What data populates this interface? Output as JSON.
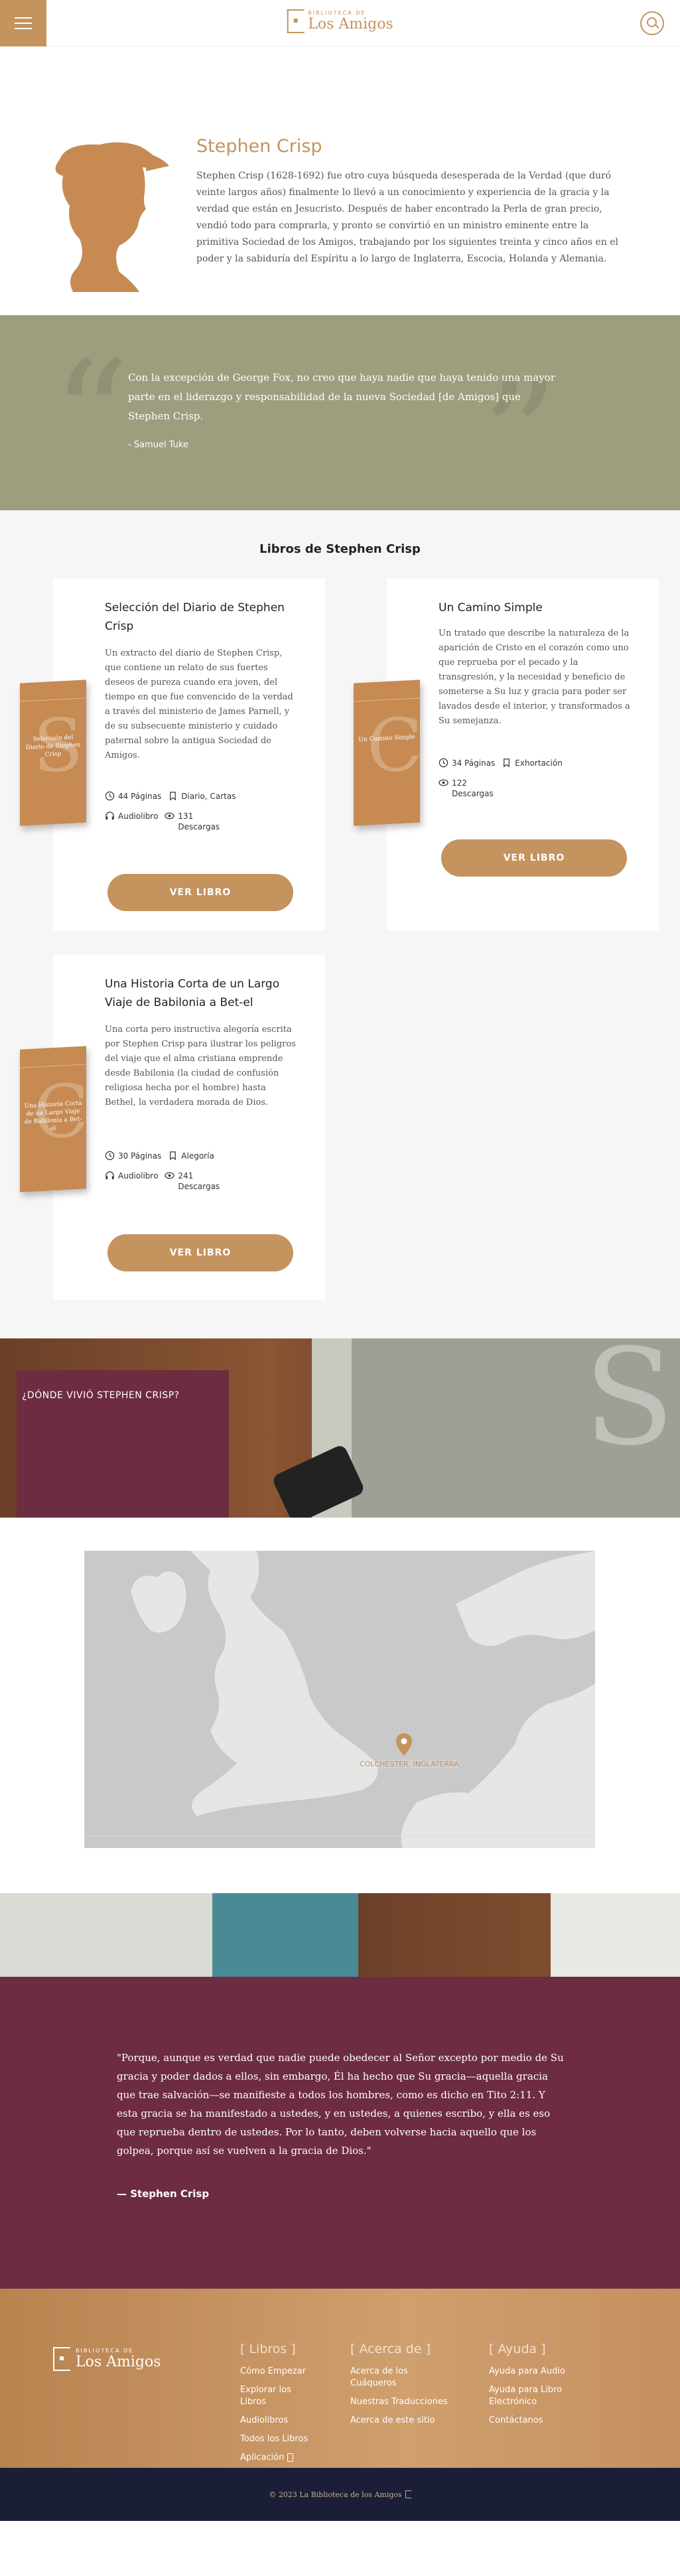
{
  "header": {
    "logo_small": "BIBLIOTECA DE",
    "logo_big": "Los Amigos",
    "icons": {
      "menu": "hamburger-icon",
      "search": "search-icon"
    },
    "accent": "#c4935e"
  },
  "author": {
    "name": "Stephen Crisp",
    "bio": "Stephen Crisp (1628-1692) fue otro cuya búsqueda desesperada de la Verdad (que duró veinte largos años) finalmente lo llevó a un conocimiento y experiencia de la gracia y la verdad que están en Jesucristo. Después de haber encontrado la Perla de gran precio, vendió todo para comprarla, y pronto se convirtió en un ministro eminente entre la primitiva Sociedad de los Amigos, trabajando por los siguientes treinta y cinco años en el poder y la sabiduría del Espíritu a lo largo de Inglaterra, Escocia, Holanda y Alemania."
  },
  "quote": {
    "text": "Con la excepción de George Fox, no creo que haya nadie que haya tenido una mayor parte en el liderazgo y responsabilidad de la nueva Sociedad [de Amigos] que Stephen Crisp.",
    "author": "- Samuel Tuke"
  },
  "books": {
    "title": "Libros de Stephen Crisp",
    "items": [
      {
        "title": "Selección del Diario de Stephen Crisp",
        "desc": "Un extracto del diario de Stephen Crisp, que contiene un relato de sus fuertes deseos de pureza cuando era joven, del tiempo en que fue convencido de la verdad a través del ministerio de James Parnell, y de su subsecuente ministerio y cuidado paternal sobre la antigua Sociedad de Amigos.",
        "pages": "44 Páginas",
        "category": "Diario, Cartas",
        "audio": "Audiolibro",
        "downloads_num": "131",
        "downloads_label": "Descargas",
        "button": "VER LIBRO",
        "cover_title": "Selección del Diario de Stephen Crisp"
      },
      {
        "title": "Un Camino Simple",
        "desc": "Un tratado que describe la naturaleza de la aparición de Cristo en el corazón como uno que reprueba por el pecado y la transgresión, y la necesidad y beneficio de someterse a Su luz y gracia para poder ser lavados desde el interior, y transformados a Su semejanza.",
        "pages": "34 Páginas",
        "category": "Exhortación",
        "downloads_num": "122",
        "downloads_label": "Descargas",
        "button": "VER LIBRO",
        "cover_title": "Un Camino Simple"
      },
      {
        "title": "Una Historia Corta de un Largo Viaje de Babilonia a Bet-el",
        "desc": "Una corta pero instructiva alegoría escrita por Stephen Crisp para ilustrar los peligros del viaje que el alma cristiana emprende desde Babilonia (la ciudad de confusión religiosa hecha por el hombre) hasta Bethel, la verdadera morada de Dios.",
        "pages": "30 Páginas",
        "category": "Alegoría",
        "audio": "Audiolibro",
        "downloads_num": "241",
        "downloads_label": "Descargas",
        "button": "VER LIBRO",
        "cover_title": "Una Historia Corta de un Largo Viaje de Babilonia a Bet-el"
      }
    ]
  },
  "where": {
    "title": "¿DÓNDE VIVIÓ STEPHEN CRISP?",
    "map_label": "COLCHESTER, INGLATERRA"
  },
  "big_quote": {
    "text": "\"Porque, aunque es verdad que nadie puede obedecer al Señor excepto por medio de Su gracia y poder dados a ellos, sin embargo, Él ha hecho que Su gracia—aquella gracia que trae salvación—se manifieste a todos los hombres, como es dicho en Tito 2:11. Y esta gracia se ha manifestado a ustedes, y en ustedes, a quienes escribo, y ella es eso que reprueba dentro de ustedes. Por lo tanto, deben volverse hacia aquello que los golpea, porque así se vuelven a la gracia de Dios.\"",
    "author": "— Stephen Crisp"
  },
  "footer": {
    "logo_small": "BIBLIOTECA DE",
    "logo_big": "Los Amigos",
    "columns": [
      {
        "title": "[ Libros ]",
        "links": [
          "Cómo Empezar",
          "Explorar los Libros",
          "Audiolibros",
          "Todos los Libros",
          "Aplicación"
        ]
      },
      {
        "title": "[ Acerca de ]",
        "links": [
          "Acerca de los Cuáqueros",
          "Nuestras Traducciones",
          "Acerca de este sitio"
        ]
      },
      {
        "title": "[ Ayuda ]",
        "links": [
          "Ayuda para Audio",
          "Ayuda para Libro Electrónico",
          "Contáctanos"
        ]
      }
    ],
    "copyright": "© 2023 La Biblioteca de los Amigos"
  }
}
